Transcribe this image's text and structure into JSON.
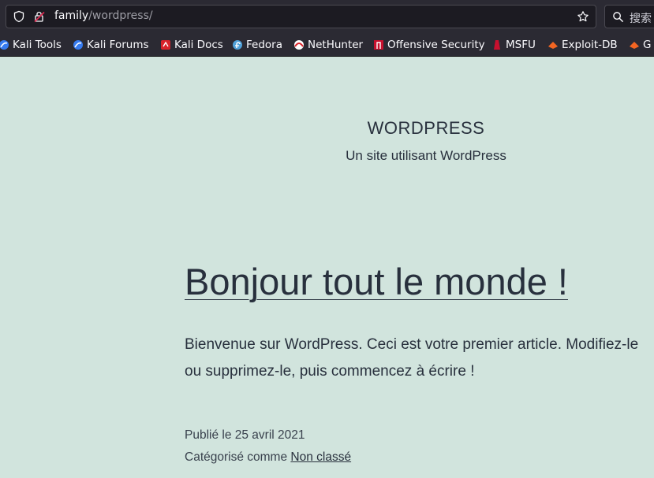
{
  "browser": {
    "url_host": "family",
    "url_path": "/wordpress/",
    "search_placeholder": "搜索",
    "bookmarks": [
      {
        "label": "Kali Tools",
        "icon": "kali-icon"
      },
      {
        "label": "Kali Forums",
        "icon": "kali-icon"
      },
      {
        "label": "Kali Docs",
        "icon": "kali-docs-icon"
      },
      {
        "label": "Fedora",
        "icon": "fedora-icon"
      },
      {
        "label": "NetHunter",
        "icon": "nethunter-icon"
      },
      {
        "label": "Offensive Security",
        "icon": "offsec-icon"
      },
      {
        "label": "MSFU",
        "icon": "msfu-icon"
      },
      {
        "label": "Exploit-DB",
        "icon": "exploitdb-icon"
      },
      {
        "label": "G",
        "icon": "exploitdb-icon"
      }
    ]
  },
  "site": {
    "title": "WORDPRESS",
    "description": "Un site utilisant WordPress"
  },
  "post": {
    "title": "Bonjour tout le monde !",
    "excerpt_line1": "Bienvenue sur WordPress. Ceci est votre premier article. Modifiez-le",
    "excerpt_line2": "ou supprimez-le, puis commencez à écrire !",
    "published": "Publié le 25 avril 2021",
    "category_prefix": "Catégorisé comme ",
    "category": "Non classé"
  },
  "colors": {
    "page_background": "#d1e4dd",
    "chrome_background": "#2b2a33",
    "text": "#28303d"
  }
}
